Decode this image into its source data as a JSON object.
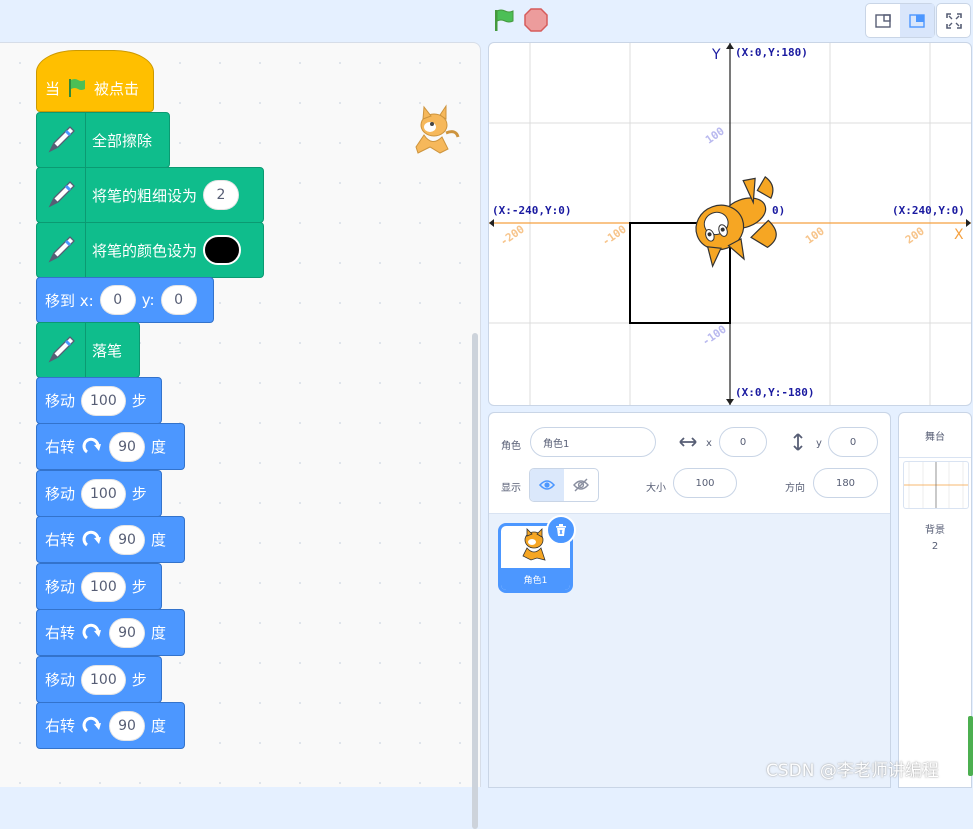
{
  "controls": {
    "green_flag": "green-flag-icon",
    "stop": "stop-icon"
  },
  "layout_buttons": [
    "small-stage-icon",
    "normal-stage-icon",
    "fullscreen-icon"
  ],
  "code_blocks": {
    "when_flag": {
      "before": "当",
      "after": "被点击"
    },
    "erase_all": "全部擦除",
    "set_pen_size": {
      "label": "将笔的粗细设为",
      "value": "2"
    },
    "set_pen_color": {
      "label": "将笔的颜色设为",
      "color": "#000000"
    },
    "goto": {
      "label": "移到 x:",
      "x": "0",
      "y_label": "y:",
      "y": "0"
    },
    "pen_down": "落笔",
    "steps": [
      {
        "move_label": "移动",
        "move_value": "100",
        "move_unit": "步",
        "turn_label": "右转",
        "turn_value": "90",
        "turn_unit": "度"
      },
      {
        "move_label": "移动",
        "move_value": "100",
        "move_unit": "步",
        "turn_label": "右转",
        "turn_value": "90",
        "turn_unit": "度"
      },
      {
        "move_label": "移动",
        "move_value": "100",
        "move_unit": "步",
        "turn_label": "右转",
        "turn_value": "90",
        "turn_unit": "度"
      },
      {
        "move_label": "移动",
        "move_value": "100",
        "move_unit": "步",
        "turn_label": "右转",
        "turn_value": "90",
        "turn_unit": "度"
      }
    ]
  },
  "stage": {
    "axis_y": "Y",
    "axis_x": "X",
    "top": "(X:0,Y:180)",
    "bottom": "(X:0,Y:-180)",
    "left": "(X:-240,Y:0)",
    "right": "(X:240,Y:0)",
    "origin_fragment": "0)",
    "tick_x": [
      "-200",
      "-100",
      "100",
      "200"
    ],
    "tick_y": [
      "100",
      "-100"
    ]
  },
  "sprite_info": {
    "sprite_label": "角色",
    "sprite_name": "角色1",
    "x_label": "x",
    "x": "0",
    "y_label": "y",
    "y": "0",
    "show_label": "显示",
    "size_label": "大小",
    "size": "100",
    "direction_label": "方向",
    "direction": "180"
  },
  "sprites": [
    {
      "name": "角色1"
    }
  ],
  "stage_panel": {
    "title": "舞台",
    "backdrops_label": "背景",
    "backdrops_count": "2"
  },
  "watermark": "CSDN @李老师讲编程"
}
